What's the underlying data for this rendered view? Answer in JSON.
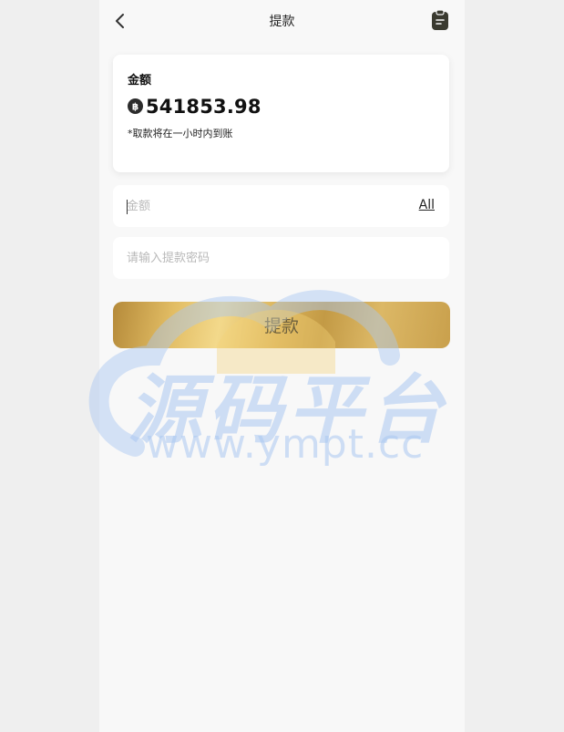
{
  "header": {
    "title": "提款",
    "back_icon": "chevron-left-icon",
    "record_icon": "clipboard-icon"
  },
  "balance": {
    "label": "金额",
    "amount": "541853.98",
    "coin_icon": "baht-coin-icon",
    "note": "*取款将在一小时内到账"
  },
  "amount_input": {
    "placeholder": "金额",
    "value": "",
    "all_label": "All"
  },
  "password_input": {
    "placeholder": "请输入提款密码",
    "value": ""
  },
  "submit": {
    "label": "提款"
  },
  "watermark": {
    "title": "源码平台",
    "url": "www.ympt.cc"
  },
  "colors": {
    "button_gold": "#d6b05a",
    "page_bg": "#f8f8f8",
    "outer_bg": "#efefef",
    "watermark_blue": "#aac6f0"
  }
}
